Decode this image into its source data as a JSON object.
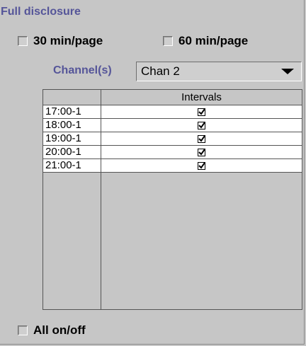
{
  "panel": {
    "title": "Full disclosure"
  },
  "options": {
    "min30": {
      "label": "30 min/page",
      "checked": false
    },
    "min60": {
      "label": "60 min/page",
      "checked": false
    }
  },
  "channel": {
    "label": "Channel(s)",
    "selected": "Chan 2"
  },
  "table": {
    "header": "Intervals",
    "rows": [
      {
        "label": "17:00-1",
        "checked": true
      },
      {
        "label": "18:00-1",
        "checked": true
      },
      {
        "label": "19:00-1",
        "checked": true
      },
      {
        "label": "20:00-1",
        "checked": true
      },
      {
        "label": "21:00-1",
        "checked": true
      }
    ]
  },
  "all_toggle": {
    "label": "All on/off",
    "checked": false
  },
  "colors": {
    "accent_text": "#555599",
    "background": "#c6c6c6"
  }
}
